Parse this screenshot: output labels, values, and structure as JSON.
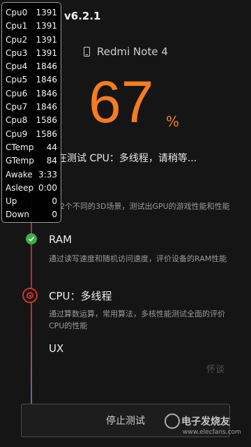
{
  "header": {
    "title": "v6.2.1"
  },
  "device": {
    "name": "Redmi Note 4"
  },
  "progress": {
    "value": "67",
    "unit": "%"
  },
  "status": {
    "text": "在测试 CPU：多线程，请稍等..."
  },
  "tests": [
    {
      "title": "",
      "desc": "2个不同的3D场景，测试出GPU的游戏性能和性能"
    },
    {
      "title": "RAM",
      "desc": "通过读写速度和随机访问速度，评价设备的RAM性能",
      "state": "done"
    },
    {
      "title": "CPU：多线程",
      "desc": "通过算数运算，常用算法，多核性能测试全面的评价CPU的性能",
      "state": "running"
    },
    {
      "title": "UX",
      "desc": ""
    }
  ],
  "stop_button": {
    "label": "停止测试"
  },
  "overlay": {
    "rows": [
      {
        "label": "Cpu0",
        "value": "1391"
      },
      {
        "label": "Cpu1",
        "value": "1391"
      },
      {
        "label": "Cpu2",
        "value": "1391"
      },
      {
        "label": "Cpu3",
        "value": "1391"
      },
      {
        "label": "Cpu4",
        "value": "1846"
      },
      {
        "label": "Cpu5",
        "value": "1846"
      },
      {
        "label": "Cpu6",
        "value": "1846"
      },
      {
        "label": "Cpu7",
        "value": "1846"
      },
      {
        "label": "Cpu8",
        "value": "1586"
      },
      {
        "label": "Cpu9",
        "value": "1586"
      },
      {
        "label": "CTemp",
        "value": "44"
      },
      {
        "label": "GTemp",
        "value": "84"
      },
      {
        "label": "Awake",
        "value": "3:33"
      },
      {
        "label": "Asleep",
        "value": "0:00"
      },
      {
        "label": "Up",
        "value": "0"
      },
      {
        "label": "Down",
        "value": "0"
      }
    ]
  },
  "watermark": {
    "main": "电子发烧友",
    "url": "www.elecfans.com",
    "ghost": "怀谈"
  },
  "colors": {
    "accent": "#f57c20",
    "done": "#3cb043",
    "running": "#d23030"
  }
}
